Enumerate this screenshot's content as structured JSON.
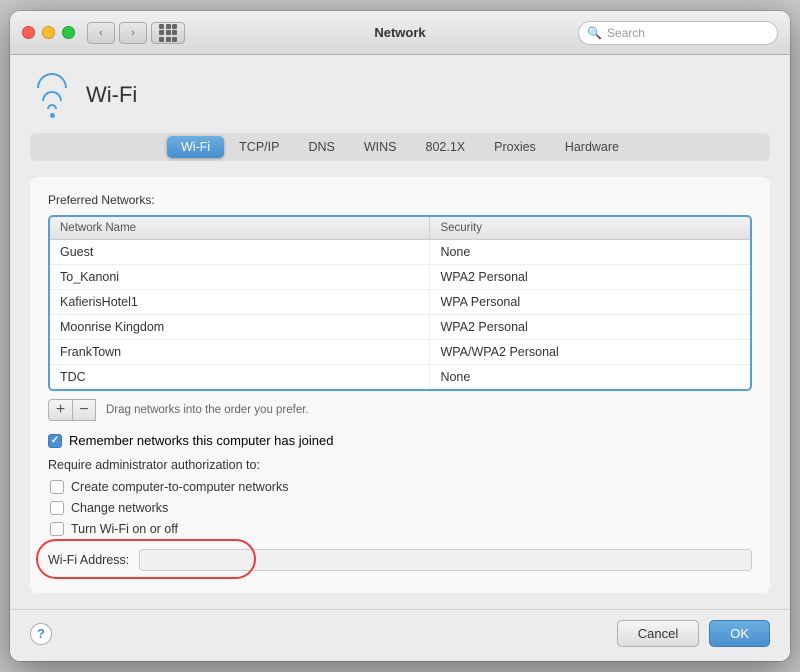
{
  "titlebar": {
    "title": "Network",
    "search_placeholder": "Search"
  },
  "wifi": {
    "label": "Wi-Fi",
    "icon": "wifi-icon"
  },
  "tabs": [
    {
      "id": "wifi",
      "label": "Wi-Fi",
      "active": true
    },
    {
      "id": "tcpip",
      "label": "TCP/IP",
      "active": false
    },
    {
      "id": "dns",
      "label": "DNS",
      "active": false
    },
    {
      "id": "wins",
      "label": "WINS",
      "active": false
    },
    {
      "id": "8021x",
      "label": "802.1X",
      "active": false
    },
    {
      "id": "proxies",
      "label": "Proxies",
      "active": false
    },
    {
      "id": "hardware",
      "label": "Hardware",
      "active": false
    }
  ],
  "preferred_networks": {
    "section_label": "Preferred Networks:",
    "columns": [
      {
        "key": "name",
        "label": "Network Name"
      },
      {
        "key": "security",
        "label": "Security"
      }
    ],
    "rows": [
      {
        "name": "Guest",
        "security": "None"
      },
      {
        "name": "To_Kanoni",
        "security": "WPA2 Personal"
      },
      {
        "name": "KafierisHotel1",
        "security": "WPA Personal"
      },
      {
        "name": "Moonrise Kingdom",
        "security": "WPA2 Personal"
      },
      {
        "name": "FrankTown",
        "security": "WPA/WPA2 Personal"
      },
      {
        "name": "TDC",
        "security": "None"
      }
    ],
    "drag_hint": "Drag networks into the order you prefer.",
    "add_label": "+",
    "remove_label": "−"
  },
  "remember_checkbox": {
    "label": "Remember networks this computer has joined",
    "checked": true
  },
  "require_admin": {
    "label": "Require administrator authorization to:",
    "options": [
      {
        "label": "Create computer-to-computer networks",
        "checked": false
      },
      {
        "label": "Change networks",
        "checked": false
      },
      {
        "label": "Turn Wi-Fi on or off",
        "checked": false
      }
    ]
  },
  "wifi_address": {
    "label": "Wi-Fi Address:",
    "value": ""
  },
  "footer": {
    "help_label": "?",
    "cancel_label": "Cancel",
    "ok_label": "OK"
  }
}
